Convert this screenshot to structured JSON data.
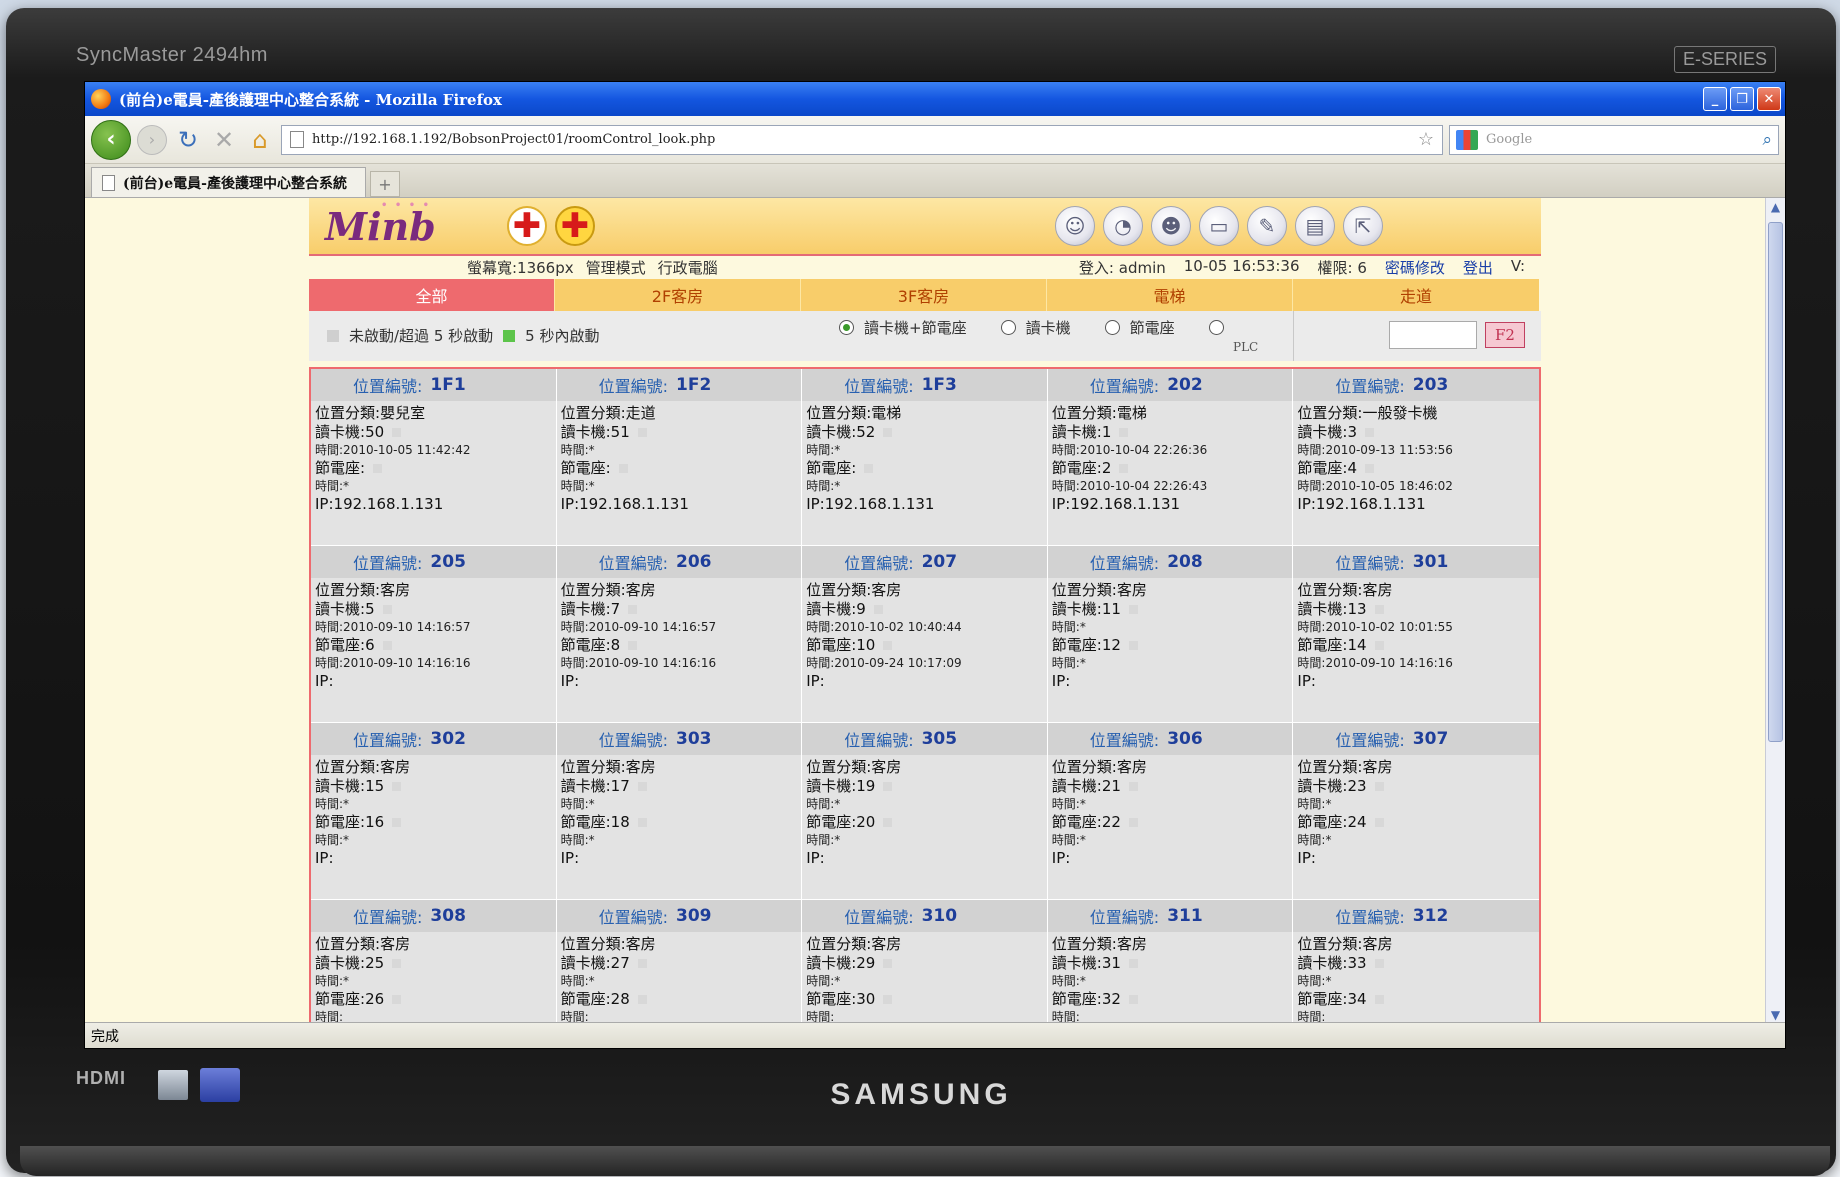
{
  "monitor": {
    "model": "SyncMaster 2494hm",
    "tag": "E-SERIES",
    "hdmi": "HDMI",
    "brand": "SAMSUNG"
  },
  "browser": {
    "title": "(前台)e電員-產後護理中心整合系統 - Mozilla Firefox",
    "url": "http://192.168.1.192/BobsonProject01/roomControl_look.php",
    "search_placeholder": "Google",
    "tab_label": "(前台)e電員-產後護理中心整合系統",
    "new_tab": "+",
    "status": "完成"
  },
  "app": {
    "logo": "Minb",
    "header_info": {
      "screen_width": "螢幕寬:1366px",
      "mode": "管理模式",
      "computer": "行政電腦",
      "login_label": "登入:",
      "user": "admin",
      "datetime": "10-05 16:53:36",
      "permission": "權限: 6",
      "change_password": "密碼修改",
      "logout": "登出",
      "version": "V:"
    },
    "categories": [
      "全部",
      "2F客房",
      "3F客房",
      "電梯",
      "走道"
    ],
    "active_category": "全部",
    "legend": {
      "inactive": "未啟動/超過 5 秒啟動",
      "active": "5 秒內啟動"
    },
    "radios": [
      {
        "label": "讀卡機+節電座",
        "checked": true
      },
      {
        "label": "讀卡機",
        "checked": false
      },
      {
        "label": "節電座",
        "checked": false
      },
      {
        "label": "PLC",
        "checked": false
      }
    ],
    "search_button": "F2",
    "labels": {
      "position_no": "位置編號:",
      "category": "位置分類:",
      "reader": "讀卡機:",
      "socket": "節電座:",
      "time": "時間:",
      "ip": "IP:"
    },
    "cards": [
      {
        "no": "1F1",
        "category": "嬰兒室",
        "reader": "50",
        "reader_time": "2010-10-05 11:42:42",
        "socket": "",
        "socket_time": "*",
        "ip": "192.168.1.131"
      },
      {
        "no": "1F2",
        "category": "走道",
        "reader": "51",
        "reader_time": "*",
        "socket": "",
        "socket_time": "*",
        "ip": "192.168.1.131"
      },
      {
        "no": "1F3",
        "category": "電梯",
        "reader": "52",
        "reader_time": "*",
        "socket": "",
        "socket_time": "*",
        "ip": "192.168.1.131"
      },
      {
        "no": "202",
        "category": "電梯",
        "reader": "1",
        "reader_time": "2010-10-04 22:26:36",
        "socket": "2",
        "socket_time": "2010-10-04 22:26:43",
        "ip": "192.168.1.131"
      },
      {
        "no": "203",
        "category": "一般發卡機",
        "reader": "3",
        "reader_time": "2010-09-13 11:53:56",
        "socket": "4",
        "socket_time": "2010-10-05 18:46:02",
        "ip": "192.168.1.131"
      },
      {
        "no": "205",
        "category": "客房",
        "reader": "5",
        "reader_time": "2010-09-10 14:16:57",
        "socket": "6",
        "socket_time": "2010-09-10 14:16:16",
        "ip": ""
      },
      {
        "no": "206",
        "category": "客房",
        "reader": "7",
        "reader_time": "2010-09-10 14:16:57",
        "socket": "8",
        "socket_time": "2010-09-10 14:16:16",
        "ip": ""
      },
      {
        "no": "207",
        "category": "客房",
        "reader": "9",
        "reader_time": "2010-10-02 10:40:44",
        "socket": "10",
        "socket_time": "2010-09-24 10:17:09",
        "ip": ""
      },
      {
        "no": "208",
        "category": "客房",
        "reader": "11",
        "reader_time": "*",
        "socket": "12",
        "socket_time": "*",
        "ip": ""
      },
      {
        "no": "301",
        "category": "客房",
        "reader": "13",
        "reader_time": "2010-10-02 10:01:55",
        "socket": "14",
        "socket_time": "2010-09-10 14:16:16",
        "ip": ""
      },
      {
        "no": "302",
        "category": "客房",
        "reader": "15",
        "reader_time": "*",
        "socket": "16",
        "socket_time": "*",
        "ip": ""
      },
      {
        "no": "303",
        "category": "客房",
        "reader": "17",
        "reader_time": "*",
        "socket": "18",
        "socket_time": "*",
        "ip": ""
      },
      {
        "no": "305",
        "category": "客房",
        "reader": "19",
        "reader_time": "*",
        "socket": "20",
        "socket_time": "*",
        "ip": ""
      },
      {
        "no": "306",
        "category": "客房",
        "reader": "21",
        "reader_time": "*",
        "socket": "22",
        "socket_time": "*",
        "ip": ""
      },
      {
        "no": "307",
        "category": "客房",
        "reader": "23",
        "reader_time": "*",
        "socket": "24",
        "socket_time": "*",
        "ip": ""
      },
      {
        "no": "308",
        "category": "客房",
        "reader": "25",
        "reader_time": "*",
        "socket": "26",
        "socket_time": "",
        "ip": ""
      },
      {
        "no": "309",
        "category": "客房",
        "reader": "27",
        "reader_time": "*",
        "socket": "28",
        "socket_time": "",
        "ip": ""
      },
      {
        "no": "310",
        "category": "客房",
        "reader": "29",
        "reader_time": "*",
        "socket": "30",
        "socket_time": "",
        "ip": ""
      },
      {
        "no": "311",
        "category": "客房",
        "reader": "31",
        "reader_time": "*",
        "socket": "32",
        "socket_time": "",
        "ip": ""
      },
      {
        "no": "312",
        "category": "客房",
        "reader": "33",
        "reader_time": "*",
        "socket": "34",
        "socket_time": "",
        "ip": ""
      }
    ]
  }
}
